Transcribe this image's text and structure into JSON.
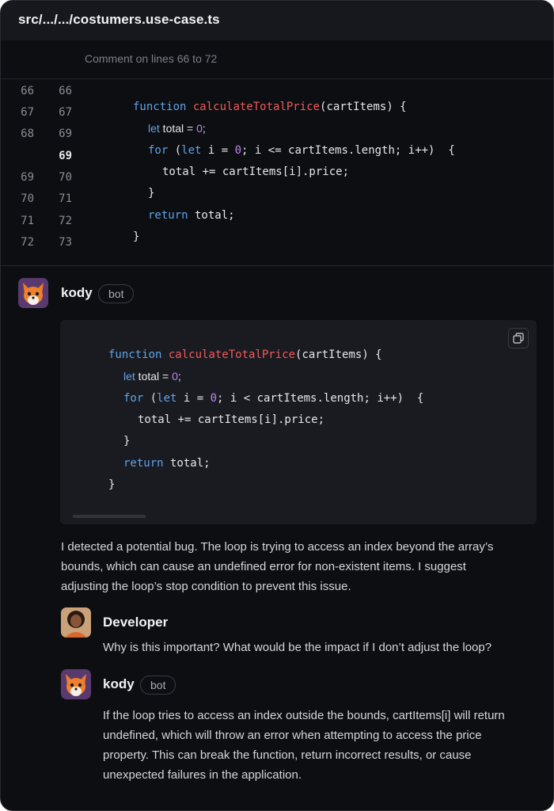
{
  "header": {
    "file_path": "src/.../.../costumers.use-case.ts"
  },
  "diff": {
    "comment_label": "Comment on lines 66 to 72",
    "old_numbers": [
      "66",
      "67",
      "68",
      "",
      "69",
      "70",
      "71",
      "72"
    ],
    "new_numbers": [
      "66",
      "67",
      "69",
      "69",
      "70",
      "71",
      "72",
      "73"
    ],
    "lines": [
      {
        "kw1": "function",
        "fn": "calculateTotalPrice",
        "rest": "(cartItems) {"
      },
      {
        "kw": "let",
        "text": " total = ",
        "num": "0",
        "tail": ";"
      },
      {
        "kw": "for",
        "a": " (",
        "kw2": "let",
        "b": " i = ",
        "num": "0",
        "c": "; i <= cartItems.length; i++)  {"
      },
      {
        "text": "total += cartItems[i].price;"
      },
      {
        "text": "}"
      },
      {
        "kw": "return",
        "text": " total;"
      },
      {
        "text": "}"
      }
    ]
  },
  "bot_comment": {
    "author": "kody",
    "badge": "bot",
    "suggestion_lines": [
      {
        "kw1": "function",
        "fn": "calculateTotalPrice",
        "rest": "(cartItems) {"
      },
      {
        "kw": "let",
        "text": " total = ",
        "num": "0",
        "tail": ";"
      },
      {
        "kw": "for",
        "a": " (",
        "kw2": "let",
        "b": " i = ",
        "num": "0",
        "c": "; i < cartItems.length; i++)  {"
      },
      {
        "text": "total += cartItems[i].price;"
      },
      {
        "text": "}"
      },
      {
        "kw": "return",
        "text": " total;"
      },
      {
        "text": "}"
      }
    ],
    "message_lines": [
      " I detected a potential bug. The loop is trying to access an index beyond the array’s",
      "bounds, which can cause an undefined error for non-existent items. I suggest",
      "adjusting the loop’s stop condition to prevent this issue."
    ]
  },
  "reply_developer": {
    "author": "Developer",
    "message": "Why is this important? What would be the impact if I don’t adjust the loop?"
  },
  "reply_bot": {
    "author": "kody",
    "badge": "bot",
    "message_lines": [
      "If the loop tries to access an index outside the bounds, cartItems[i] will return",
      "undefined, which will throw an error when attempting to access the price",
      "property. This can break the function, return incorrect results, or cause",
      "unexpected failures in the application."
    ]
  },
  "icons": {
    "copy": "copy-icon",
    "kody_avatar": "fox-avatar-icon",
    "developer_avatar": "developer-avatar"
  },
  "colors": {
    "background": "#0d0e12",
    "keyword": "#5fa3e8",
    "function_name": "#f05a5a",
    "number": "#b987ef"
  }
}
